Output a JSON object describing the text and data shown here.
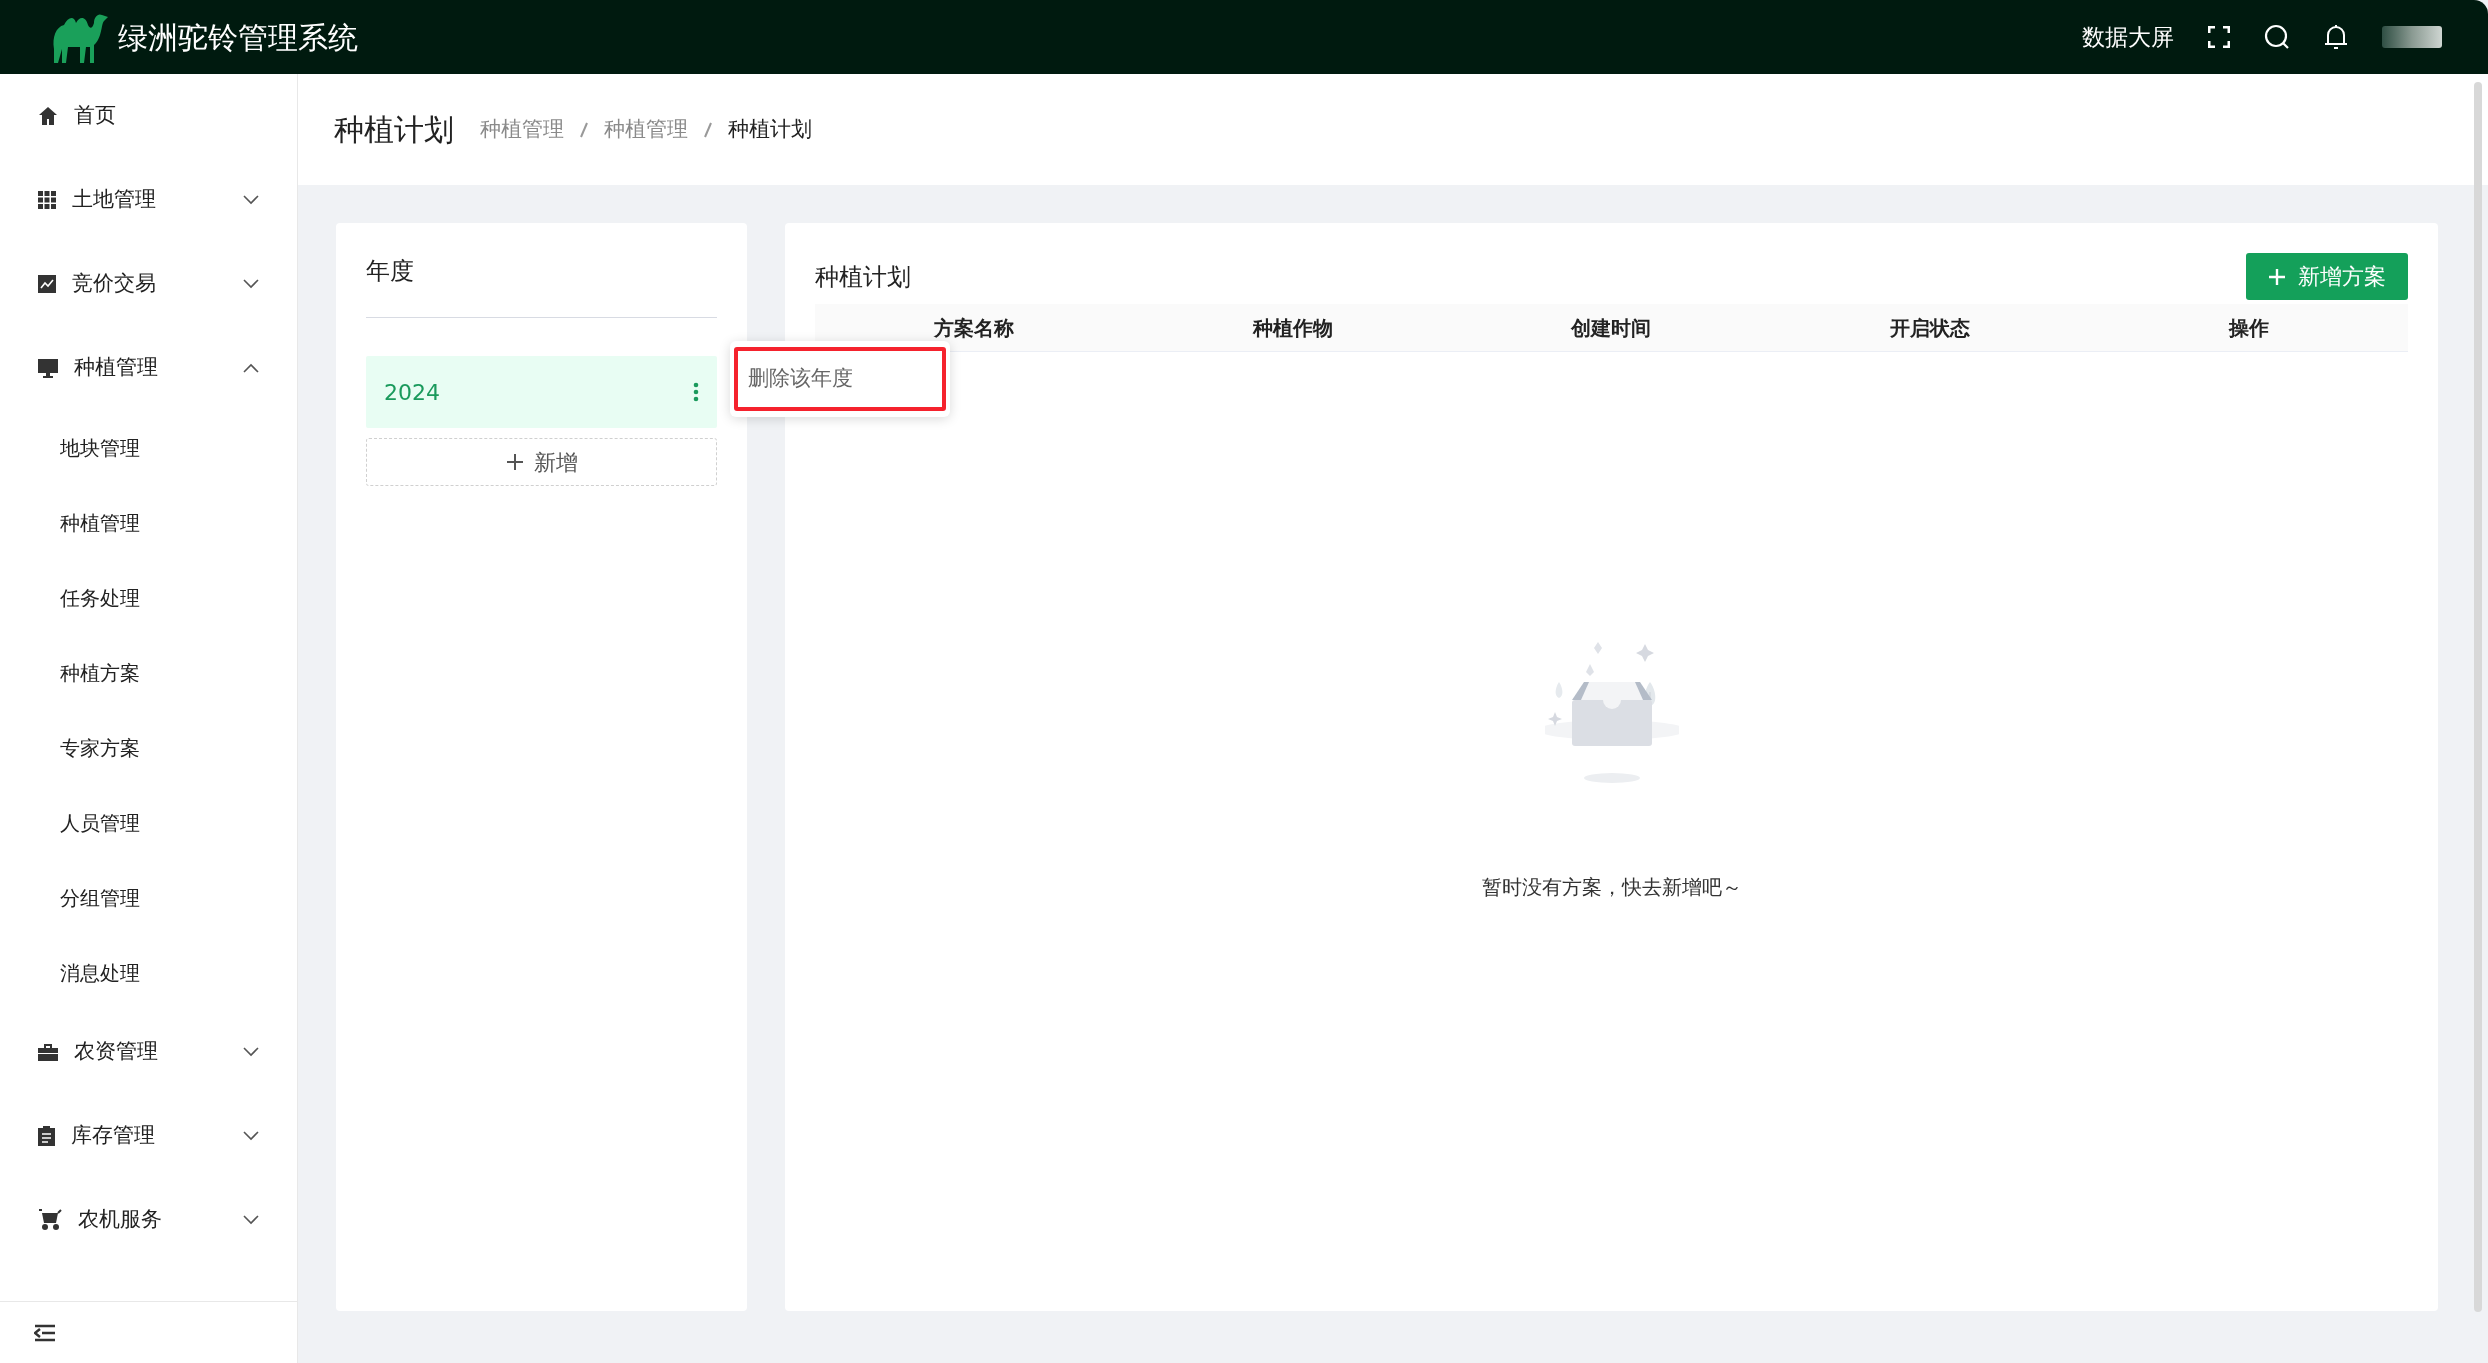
{
  "app": {
    "title": "绿洲驼铃管理系统"
  },
  "header": {
    "actions": [
      {
        "kind": "text",
        "label": "数据大屏"
      },
      {
        "kind": "fullscreen"
      },
      {
        "kind": "search"
      },
      {
        "kind": "bell"
      },
      {
        "kind": "avatar"
      }
    ]
  },
  "sidebar": {
    "items": [
      {
        "label": "首页"
      },
      {
        "label": "土地管理",
        "expanded": false
      },
      {
        "label": "竞价交易",
        "expanded": false
      },
      {
        "label": "种植管理",
        "expanded": true,
        "children": [
          {
            "label": "地块管理"
          },
          {
            "label": "种植管理"
          },
          {
            "label": "任务处理"
          },
          {
            "label": "种植方案"
          },
          {
            "label": "专家方案"
          },
          {
            "label": "人员管理"
          },
          {
            "label": "分组管理"
          },
          {
            "label": "消息处理"
          }
        ]
      },
      {
        "label": "农资管理",
        "expanded": false
      },
      {
        "label": "库存管理",
        "expanded": false
      },
      {
        "label": "农机服务",
        "expanded": false
      }
    ]
  },
  "page": {
    "title": "种植计划",
    "breadcrumb": [
      {
        "label": "种植管理",
        "current": false
      },
      {
        "label": "种植管理",
        "current": false
      },
      {
        "label": "种植计划",
        "current": true
      }
    ]
  },
  "year_panel": {
    "title": "年度",
    "years": [
      {
        "label": "2024",
        "selected": true
      }
    ],
    "add_button": "新增",
    "menu": {
      "items": [
        {
          "label": "删除该年度",
          "highlighted": true
        }
      ]
    }
  },
  "plan_panel": {
    "title": "种植计划",
    "add_button": "新增方案",
    "columns": [
      "方案名称",
      "种植作物",
      "创建时间",
      "开启状态",
      "操作"
    ],
    "empty_text": "暂时没有方案，快去新增吧～"
  }
}
